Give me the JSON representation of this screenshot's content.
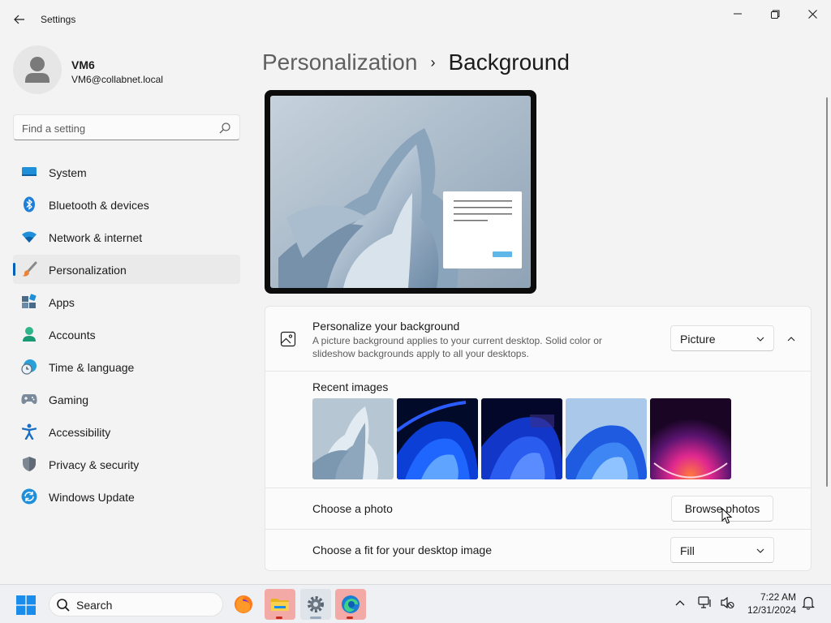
{
  "window": {
    "title": "Settings"
  },
  "user": {
    "name": "VM6",
    "email": "VM6@collabnet.local"
  },
  "search": {
    "placeholder": "Find a setting"
  },
  "nav": {
    "items": [
      {
        "label": "System",
        "icon": "system-icon",
        "active": false
      },
      {
        "label": "Bluetooth & devices",
        "icon": "bluetooth-icon",
        "active": false
      },
      {
        "label": "Network & internet",
        "icon": "wifi-icon",
        "active": false
      },
      {
        "label": "Personalization",
        "icon": "brush-icon",
        "active": true
      },
      {
        "label": "Apps",
        "icon": "apps-icon",
        "active": false
      },
      {
        "label": "Accounts",
        "icon": "accounts-icon",
        "active": false
      },
      {
        "label": "Time & language",
        "icon": "clock-globe-icon",
        "active": false
      },
      {
        "label": "Gaming",
        "icon": "gamepad-icon",
        "active": false
      },
      {
        "label": "Accessibility",
        "icon": "accessibility-icon",
        "active": false
      },
      {
        "label": "Privacy & security",
        "icon": "shield-icon",
        "active": false
      },
      {
        "label": "Windows Update",
        "icon": "update-icon",
        "active": false
      }
    ]
  },
  "breadcrumb": {
    "parent": "Personalization",
    "separator": "›",
    "current": "Background"
  },
  "background": {
    "title": "Personalize your background",
    "description": "A picture background applies to your current desktop. Solid color or slideshow backgrounds apply to all your desktops.",
    "type_value": "Picture",
    "recent_label": "Recent images",
    "choose_photo_label": "Choose a photo",
    "browse_label": "Browse photos",
    "fit_label": "Choose a fit for your desktop image",
    "fit_value": "Fill"
  },
  "taskbar": {
    "search_label": "Search",
    "time": "7:22 AM",
    "date": "12/31/2024"
  },
  "colors": {
    "accent": "#005fb8",
    "active_nav_bg": "#eaeaea",
    "window_bg": "#f3f3f3"
  }
}
